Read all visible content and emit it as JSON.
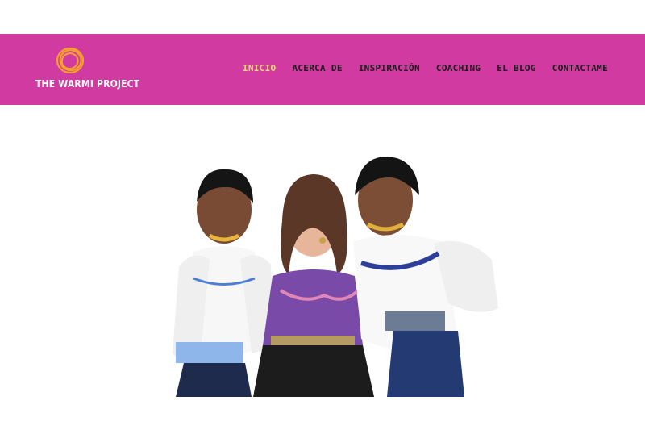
{
  "site": {
    "logo_text": "THE WARMI PROJECT",
    "logo_icon": "orange-circle-scribble-icon"
  },
  "nav": {
    "items": [
      {
        "label": "INICIO",
        "active": true
      },
      {
        "label": "ACERCA DE",
        "active": false
      },
      {
        "label": "INSPIRACIÓN",
        "active": false
      },
      {
        "label": "COACHING",
        "active": false
      },
      {
        "label": "EL BLOG",
        "active": false
      },
      {
        "label": "CONTACTAME",
        "active": false
      }
    ]
  },
  "colors": {
    "header_bg": "#d13aa0",
    "active_nav": "#f5d97a",
    "logo_orange": "#f3a12c"
  },
  "hero": {
    "alt": "Three women in traditional embroidered blouses sharing a laugh"
  }
}
